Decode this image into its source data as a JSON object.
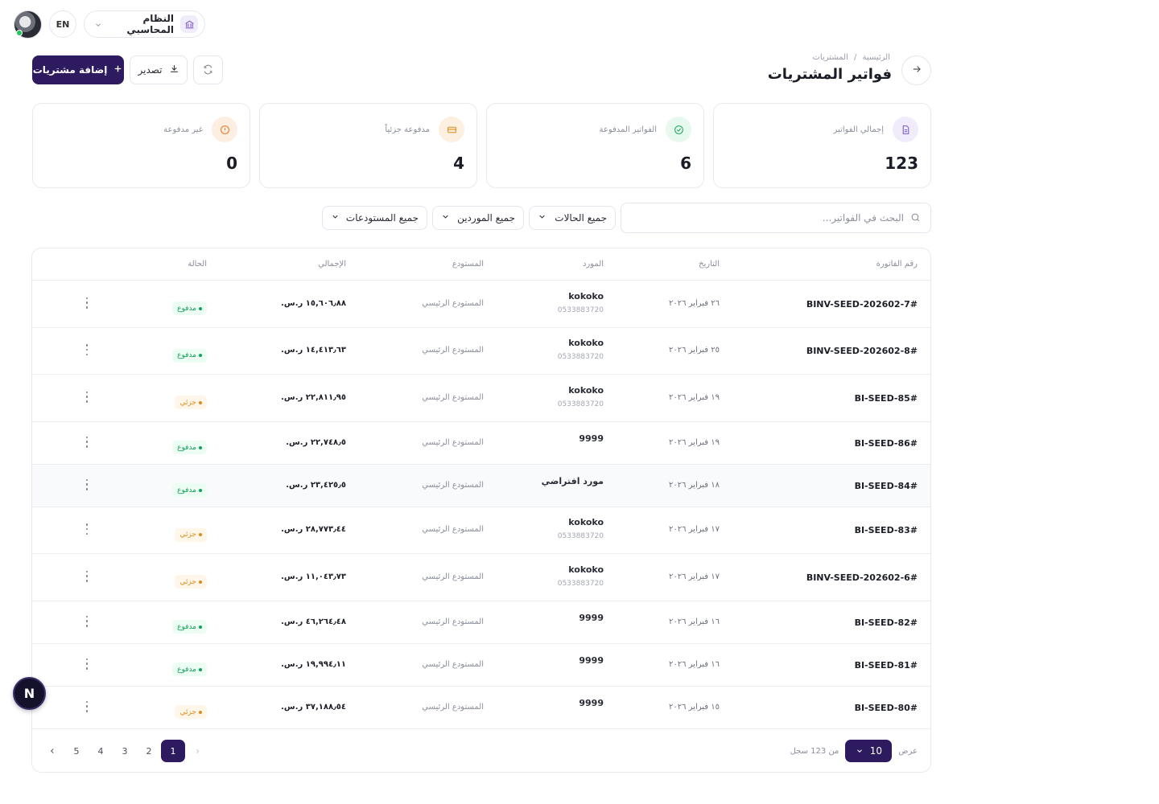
{
  "topbar": {
    "language": "EN",
    "system_label": "النظام المحاسبي"
  },
  "header": {
    "breadcrumb_home": "الرئيسية",
    "breadcrumb_sep": "/",
    "breadcrumb_current": "المشتريات",
    "title": "فواتير المشتريات",
    "add_label": "إضافة مشتريات",
    "export_label": "تصدير"
  },
  "stats": [
    {
      "label": "إجمالي الفواتير",
      "value": "123"
    },
    {
      "label": "الفواتير المدفوعة",
      "value": "6"
    },
    {
      "label": "مدفوعة جزئياً",
      "value": "4"
    },
    {
      "label": "غير مدفوعة",
      "value": "0"
    }
  ],
  "filters": {
    "search_placeholder": "البحث في الفواتير...",
    "status": "جميع الحالات",
    "suppliers": "جميع الموردين",
    "warehouses": "جميع المستودعات"
  },
  "table": {
    "headers": {
      "invoice": "رقم الفاتورة",
      "date": "التاريخ",
      "supplier": "المورد",
      "warehouse": "المستودع",
      "total": "الإجمالي",
      "status": "الحالة"
    },
    "rows": [
      {
        "invoice": "BINV-SEED-202602-7#",
        "date": "٢٦ فبراير ٢٠٢٦",
        "supplier": "kokoko",
        "phone": "0533883720",
        "warehouse": "المستودع الرئيسي",
        "total": "١٥,٦٠٦٫٨٨ ر.س.",
        "status": "مدفوع",
        "status_type": "paid"
      },
      {
        "invoice": "BINV-SEED-202602-8#",
        "date": "٢٥ فبراير ٢٠٢٦",
        "supplier": "kokoko",
        "phone": "0533883720",
        "warehouse": "المستودع الرئيسي",
        "total": "١٤,٤١٣٫٦٣ ر.س.",
        "status": "مدفوع",
        "status_type": "paid"
      },
      {
        "invoice": "BI-SEED-85#",
        "date": "١٩ فبراير ٢٠٢٦",
        "supplier": "kokoko",
        "phone": "0533883720",
        "warehouse": "المستودع الرئيسي",
        "total": "٢٢,٨١١٫٩٥ ر.س.",
        "status": "جزئي",
        "status_type": "partial"
      },
      {
        "invoice": "BI-SEED-86#",
        "date": "١٩ فبراير ٢٠٢٦",
        "supplier": "9999",
        "phone": "",
        "warehouse": "المستودع الرئيسي",
        "total": "٢٢,٧٤٨٫٥ ر.س.",
        "status": "مدفوع",
        "status_type": "paid"
      },
      {
        "invoice": "BI-SEED-84#",
        "date": "١٨ فبراير ٢٠٢٦",
        "supplier": "مورد افتراضي",
        "phone": "",
        "warehouse": "المستودع الرئيسي",
        "total": "٢٣,٤٢٥٫٥ ر.س.",
        "status": "مدفوع",
        "status_type": "paid"
      },
      {
        "invoice": "BI-SEED-83#",
        "date": "١٧ فبراير ٢٠٢٦",
        "supplier": "kokoko",
        "phone": "0533883720",
        "warehouse": "المستودع الرئيسي",
        "total": "٢٨,٧٧٣٫٤٤ ر.س.",
        "status": "جزئي",
        "status_type": "partial"
      },
      {
        "invoice": "BINV-SEED-202602-6#",
        "date": "١٧ فبراير ٢٠٢٦",
        "supplier": "kokoko",
        "phone": "0533883720",
        "warehouse": "المستودع الرئيسي",
        "total": "١١,٠٤٣٫٧٣ ر.س.",
        "status": "جزئي",
        "status_type": "partial"
      },
      {
        "invoice": "BI-SEED-82#",
        "date": "١٦ فبراير ٢٠٢٦",
        "supplier": "9999",
        "phone": "",
        "warehouse": "المستودع الرئيسي",
        "total": "٤٦,٢٦٤٫٤٨ ر.س.",
        "status": "مدفوع",
        "status_type": "paid"
      },
      {
        "invoice": "BI-SEED-81#",
        "date": "١٦ فبراير ٢٠٢٦",
        "supplier": "9999",
        "phone": "",
        "warehouse": "المستودع الرئيسي",
        "total": "١٩,٩٩٤٫١١ ر.س.",
        "status": "مدفوع",
        "status_type": "paid"
      },
      {
        "invoice": "BI-SEED-80#",
        "date": "١٥ فبراير ٢٠٢٦",
        "supplier": "9999",
        "phone": "",
        "warehouse": "المستودع الرئيسي",
        "total": "٣٧,١٨٨٫٥٤ ر.س.",
        "status": "جزئي",
        "status_type": "partial"
      }
    ]
  },
  "pagination": {
    "show_label": "عرض",
    "page_size": "10",
    "total_label": "من 123 سجل",
    "pages": [
      "1",
      "2",
      "3",
      "4",
      "5"
    ],
    "current_page": "1"
  },
  "fab_label": "N",
  "colors": {
    "accent": "#2e1a5e",
    "paid": "#15a05a",
    "partial": "#e08b1a"
  }
}
